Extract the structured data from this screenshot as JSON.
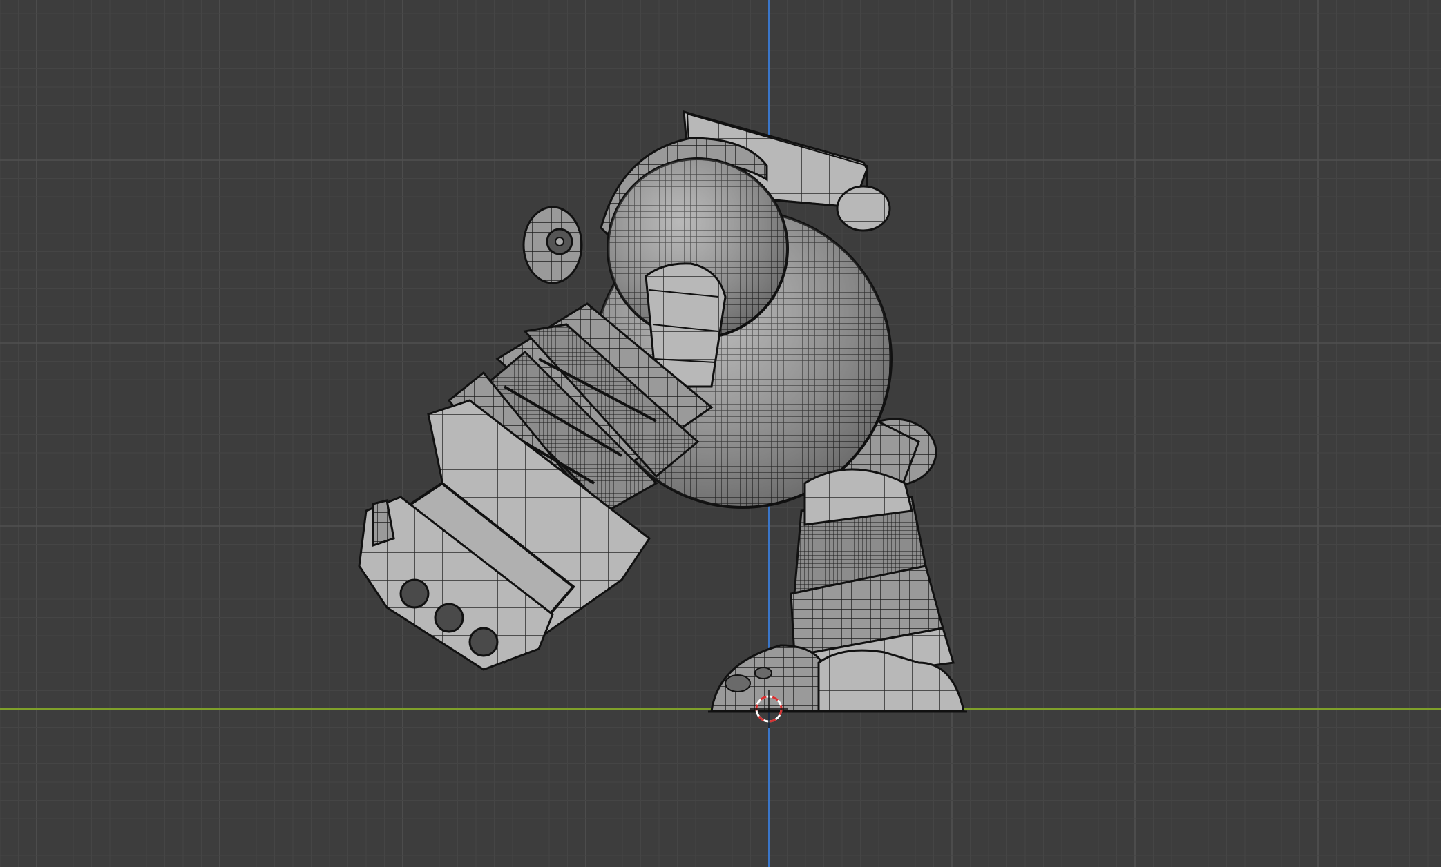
{
  "viewport": {
    "mode": "orthographic-side-view",
    "shading": "solid-with-wireframe",
    "background_color": "#3d3d3d",
    "grid_minor_color": "#454545",
    "grid_major_color": "#505050",
    "x_axis_color": "#7fa02a",
    "z_axis_color": "#3a76c9"
  },
  "model": {
    "name": "mech-robot",
    "parts": [
      "body-sphere",
      "backpack",
      "shoulder",
      "arm-upper",
      "arm-armor",
      "fist",
      "knuckles",
      "leg-knee",
      "leg-armor",
      "foot"
    ],
    "surface_color": "#9a9a9a",
    "wire_color": "#1a1a1a"
  },
  "cursor": {
    "icon": "3d-cursor-icon",
    "ring_colors": [
      "#ffffff",
      "#d83030"
    ]
  }
}
